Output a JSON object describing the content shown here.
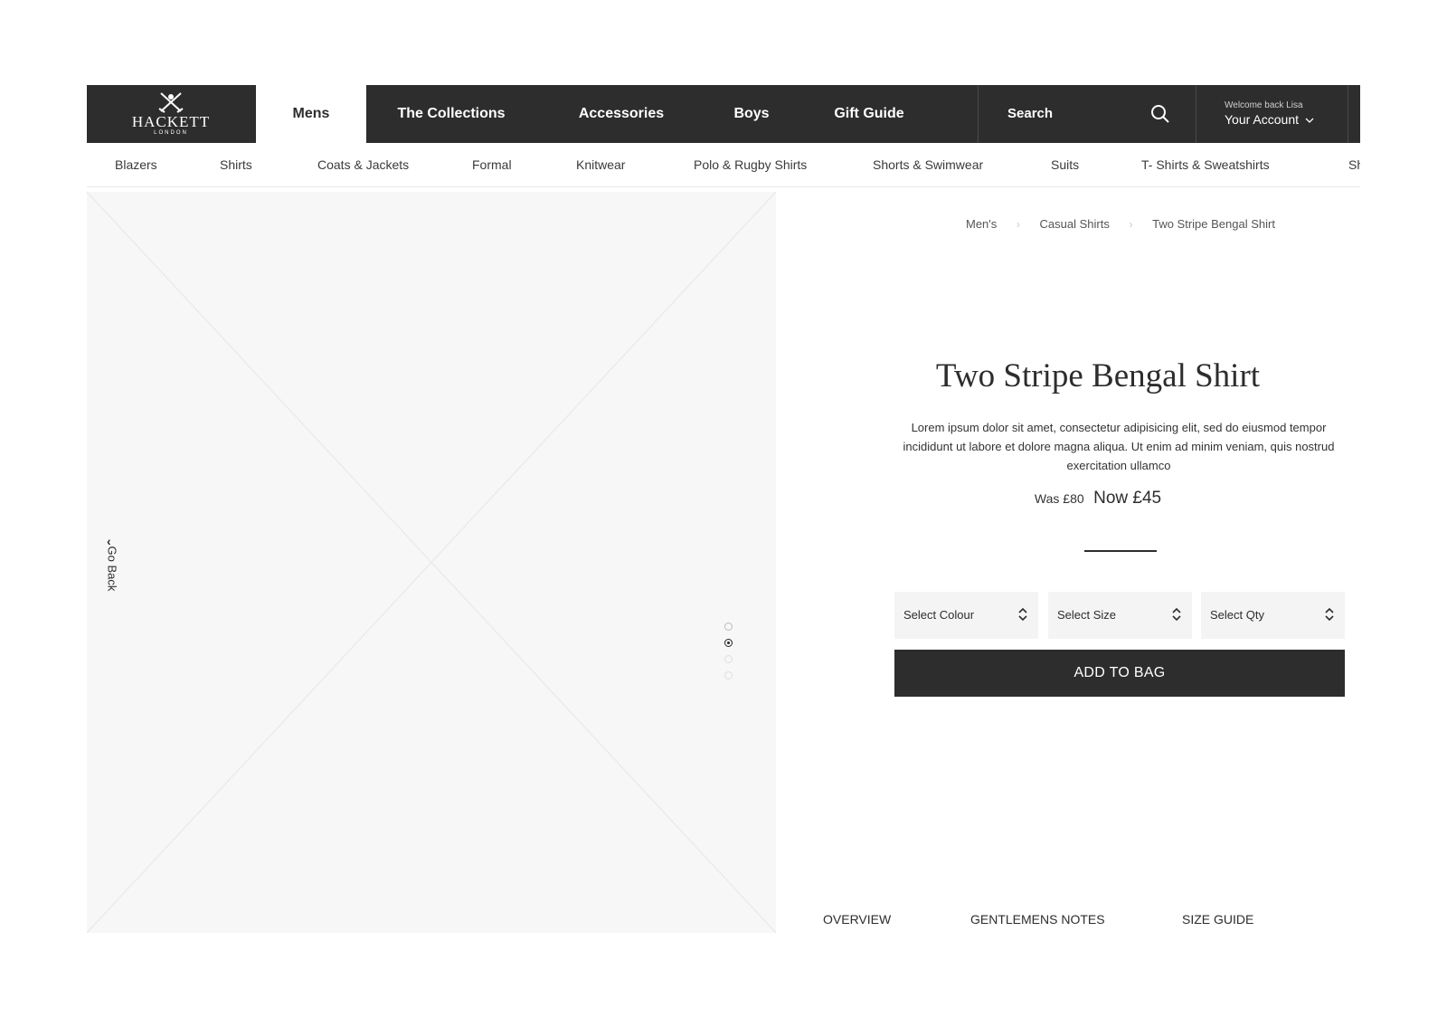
{
  "brand": {
    "name": "HACKETT",
    "sub": "LONDON"
  },
  "nav": {
    "items": [
      {
        "label": "Mens",
        "active": true
      },
      {
        "label": "The Collections"
      },
      {
        "label": "Accessories"
      },
      {
        "label": "Boys"
      },
      {
        "label": "Gift Guide"
      }
    ],
    "search_label": "Search",
    "welcome": "Welcome back Lisa",
    "account_label": "Your Account"
  },
  "subnav": {
    "items": [
      "Blazers",
      "Shirts",
      "Coats & Jackets",
      "Formal",
      "Knitwear",
      "Polo & Rugby Shirts",
      "Shorts & Swimwear",
      "Suits",
      "T- Shirts & Sweatshirts",
      "Sh"
    ]
  },
  "gallery": {
    "go_back": "Go Back",
    "slide_count": 4,
    "active_slide": 2
  },
  "breadcrumb": [
    "Men's",
    "Casual Shirts",
    "Two Stripe Bengal Shirt"
  ],
  "product": {
    "title": "Two Stripe Bengal Shirt",
    "description": "Lorem ipsum dolor sit amet, consectetur adipisicing elit, sed do eiusmod tempor incididunt ut labore et dolore magna aliqua. Ut enim ad minim veniam, quis nostrud exercitation ullamco",
    "was_price": "Was £80",
    "now_price": "Now £45"
  },
  "selects": {
    "colour": "Select Colour",
    "size": "Select Size",
    "qty": "Select Qty"
  },
  "add_to_bag": "ADD TO BAG",
  "tabs": [
    "OVERVIEW",
    "GENTLEMENS NOTES",
    "SIZE GUIDE"
  ],
  "colors": {
    "dark": "#2d2d2d",
    "panel": "#f4f4f4",
    "image_bg": "#f7f7f7"
  }
}
